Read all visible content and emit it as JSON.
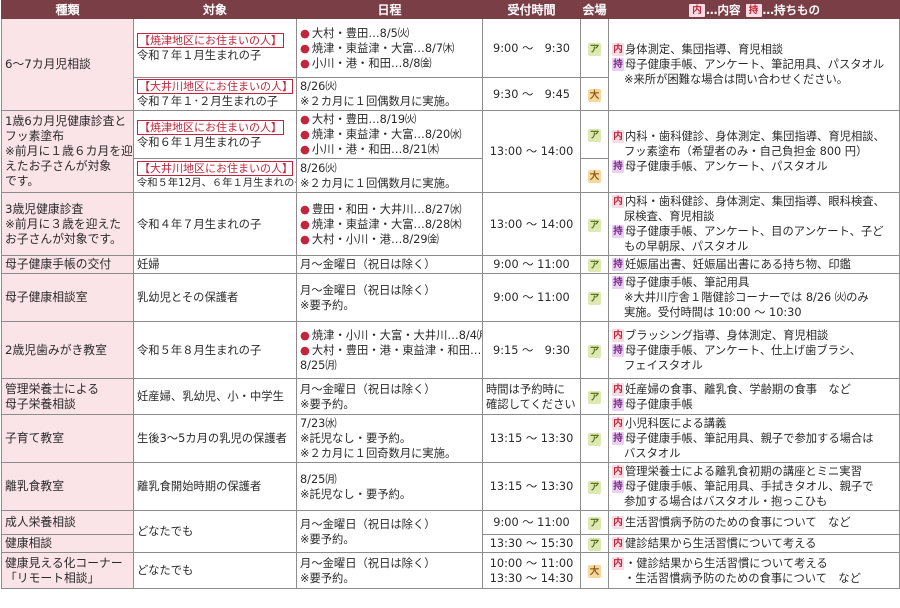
{
  "headers": {
    "type": "種類",
    "target": "対象",
    "schedule": "日程",
    "reception": "受付時間",
    "venue": "会場",
    "legend": {
      "k1": "内",
      "t1": "…内容",
      "k2": "持",
      "t2": "…持ちもの"
    }
  },
  "venue_labels": {
    "a": "ア",
    "d": "大"
  },
  "rows": [
    {
      "type": "6～7カ月児相談",
      "subs": [
        {
          "tag": "【焼津地区にお住まいの人】",
          "target": "令和７年１月生まれの子",
          "schedule": [
            "大村・豊田…8/5㈫",
            "焼津・東益津・大富…8/7㈭",
            "小川・港・和田…8/8㈮"
          ],
          "time": "9:00 ～　9:30",
          "venue": "a"
        },
        {
          "tag": "【大井川地区にお住まいの人】",
          "target": "令和７年１･２月生まれの子",
          "schedule": [
            "8/26㈫",
            "※２カ月に１回偶数月に実施。"
          ],
          "time": "9:30 ～　9:45",
          "venue": "d"
        }
      ],
      "content": [
        "内|身体測定、集団指導、育児相談",
        "持|母子健康手帳、アンケート、筆記用具、パスタオル",
        "|※来所が困難な場合は問い合わせください。"
      ]
    },
    {
      "type": [
        "1歳6カ月児健康診査と",
        "フッ素塗布",
        "※前月に１歳６カ月を迎",
        "えたお子さんが対象",
        "です。"
      ],
      "subs": [
        {
          "tag": "【焼津地区にお住まいの人】",
          "target": "令和６年１月生まれの子",
          "schedule": [
            "大村・豊田…8/19㈫",
            "焼津・東益津・大富…8/20㈬",
            "小川・港・和田…8/21㈭"
          ],
          "time": "",
          "venue": "a"
        },
        {
          "tag": "【大井川地区にお住まいの人】",
          "target": "令和５年12月、６年１月生まれの子",
          "schedule": [
            "8/26㈫",
            "※２カ月に１回偶数月に実施。"
          ],
          "time": "",
          "venue": "d"
        }
      ],
      "time": "13:00 ～ 14:00",
      "content": [
        "内|内科・歯科健診、身体測定、集団指導、育児相談、",
        "|フッ素塗布（希望者のみ・自己負担金 800 円）",
        "持|母子健康手帳、アンケート、パスタオル"
      ]
    },
    {
      "type": [
        "3歳児健康診査",
        "※前月に３歳を迎えた",
        "お子さんが対象です。"
      ],
      "target": "令和４年７月生まれの子",
      "schedule": [
        "豊田・和田・大井川…8/27㈬",
        "焼津・東益津・大富…8/28㈭",
        "大村・小川・港…8/29㈮"
      ],
      "time": "13:00 ～ 14:00",
      "venue": "a",
      "content": [
        "内|内科・歯科健診、身体測定、集団指導、眼科検査、",
        "|尿検査、育児相談",
        "持|母子健康手帳、アンケート、目のアンケート、子ど",
        "|もの早朝尿、パスタオル"
      ]
    },
    {
      "type": "母子健康手帳の交付",
      "target": "妊婦",
      "schedule": [
        "月～金曜日（祝日は除く）"
      ],
      "time": "9:00 ～ 11:00",
      "venue": "a",
      "content": [
        "持|妊娠届出書、妊娠届出書にある持ち物、印鑑"
      ]
    },
    {
      "type": "母子健康相談室",
      "target": "乳幼児とその保護者",
      "schedule": [
        "月～金曜日（祝日は除く）",
        "※要予約。"
      ],
      "time": "9:00 ～ 11:00",
      "venue": "a",
      "content": [
        "持|母子健康手帳、筆記用具",
        "|※大井川庁舎１階健診コーナーでは 8/26 ㈫のみ",
        "|実施。受付時間は 10:00 ～ 10:30"
      ]
    },
    {
      "type": "2歳児歯みがき教室",
      "target": "令和５年８月生まれの子",
      "schedule": [
        "焼津・小川・大富・大井川…8/4㈪",
        "大村・豊田・港・東益津・和田…",
        "8/25㈪"
      ],
      "time": "9:15 ～　9:30",
      "venue": "a",
      "content": [
        "内|ブラッシング指導、身体測定、育児相談",
        "持|母子健康手帳、アンケート、仕上げ歯ブラシ、",
        "|フェイスタオル"
      ]
    },
    {
      "type": [
        "管理栄養士による",
        "母子栄養相談"
      ],
      "target": "妊産婦、乳幼児、小・中学生",
      "schedule": [
        "月～金曜日（祝日は除く）",
        "※要予約。"
      ],
      "time": [
        "時間は予約時に",
        "確認してください"
      ],
      "venue": "a",
      "content": [
        "内|妊産婦の食事、離乳食、学齢期の食事　など",
        "持|母子健康手帳"
      ]
    },
    {
      "type": "子育て教室",
      "target": "生後3～5カ月の乳児の保護者",
      "schedule": [
        "7/23㈬",
        "※託児なし・要予約。",
        "※２カ月に１回奇数月に実施。"
      ],
      "time": "13:15 ～ 13:30",
      "venue": "a",
      "content": [
        "内|小児科医による講義",
        "持|母子健康手帳、筆記用具、親子で参加する場合は",
        "|バスタオル"
      ]
    },
    {
      "type": "離乳食教室",
      "target": "離乳食開始時期の保護者",
      "schedule": [
        "8/25㈪",
        "※託児なし・要予約。"
      ],
      "time": "13:15 ～ 13:30",
      "venue": "a",
      "content": [
        "内|管理栄養士による離乳食初期の講座とミニ実習",
        "持|母子健康手帳、筆記用具、手拭きタオル、親子で",
        "|参加する場合はバスタオル・抱っこひも"
      ]
    },
    {
      "type": "成人栄養相談",
      "target": "どなたでも",
      "schedule": [
        "月～金曜日（祝日は除く）",
        "※要予約。"
      ],
      "time": "9:00 ～ 11:00",
      "venue": "a",
      "content": [
        "内|生活習慣病予防のための食事について　など"
      ]
    },
    {
      "type": "健康相談",
      "time": "13:30 ～ 15:30",
      "venue": "a",
      "content": [
        "内|健診結果から生活習慣について考える"
      ]
    },
    {
      "type": [
        "健康見える化コーナー",
        "「リモート相談」"
      ],
      "target": "どなたでも",
      "schedule": [
        "月～金曜日（祝日は除く）",
        "※要予約。"
      ],
      "time": [
        "10:00 ～ 11:00",
        "13:30 ～ 14:30"
      ],
      "venue": "d",
      "content": [
        "内|・健診結果から生活習慣について考える",
        "|・生活習慣病予防のための食事について　など"
      ]
    }
  ]
}
